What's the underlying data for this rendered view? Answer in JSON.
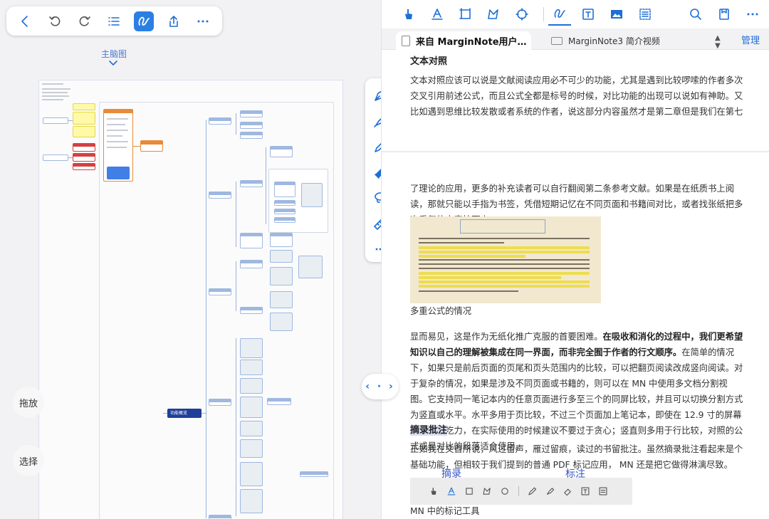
{
  "left": {
    "toolbar": {
      "icons": [
        "back-icon",
        "undo-icon",
        "redo-icon",
        "list-icon",
        "pen-draw-icon",
        "share-icon",
        "more-icon"
      ]
    },
    "mindmap_label": "主脑图",
    "func_node": "功能概览",
    "drag_label": "拖放",
    "select_label": "选择"
  },
  "pen_bar": {
    "tools": [
      "pen-icon",
      "highlighter-icon",
      "pencil-icon",
      "eraser-icon",
      "lasso-icon",
      "ruler-icon",
      "more-icon"
    ],
    "colors": {
      "pen": "#111111",
      "highlighter": "#f2c21b",
      "pencil": "#1e6fd6"
    }
  },
  "right": {
    "toolbar": {
      "icons": [
        "hand-icon",
        "text-underline-icon",
        "rect-select-icon",
        "shape-icon",
        "screenshot-icon",
        "pen-draw-icon",
        "text-box-icon",
        "image-icon",
        "outline-icon",
        "search-icon",
        "bookmark-icon",
        "more-icon"
      ],
      "accent": "#1e6fd6"
    },
    "tabs": {
      "tab1": "来自 MarginNote用户…",
      "tab2": "MarginNote3 简介视频"
    },
    "manage": "管理",
    "doc": {
      "h1": "文本对照",
      "p1": "文本对照应该可以说是文献阅读应用必不可少的功能，尤其是遇到比较啰嗦的作者多次交叉引用前述公式，而且公式全都是标号的时候，对比功能的出现可以说如有神助。又比如遇到思维比较发散或者系统的作者，说这部分内容虽然才是第二章但是我们在第七章中进行了更加深入的讨论，并且在第九章中还引入",
      "p2": "了理论的应用，更多的补充读者可以自行翻阅第二条参考文献。如果是在纸质书上阅读，那就只能以手指为书签，凭借短期记忆在不同页面和书籍间对比，或者找张纸把多次重复的内容抄下来。",
      "caption1": "多重公式的情况",
      "p3_a": "显而易见，这是作为无纸化推广克服的首要困难。",
      "p3_b": "在吸收和消化的过程中，我们更希望知识以自己的理解被集成在同一界面，而非完全囿于作者的行文顺序。",
      "p3_c": "在简单的情况下，如果只是前后页面的页尾和页头范围内的比较，可以把翻页阅读改成竖向阅读。对于复杂的情况，如果是涉及不同页面或书籍的，则可以在 MN 中使用多文档分割视图。它支持同一笔记本内的任意页面进行多至三个的同屏比较，并且可以切换分割方式为竖直或水平。水平多用于页比较，不过三个页面加上笔记本，即使在 12.9 寸的屏幕上也显得吃力，在实际使用的时候建议不要过于贪心；竖直则多用于行比较，对照的公式或是对比的段落适合使用。",
      "h2": "摘录批注",
      "p4": "正如我在文首所说，风过留声，雁过留痕，读过的书留批注。虽然摘录批注看起来是个基础功能，但相较于我们提到的普通 PDF 标记应用， MN 还是把它做得淋漓尽致。",
      "anno_excerpt": "摘录",
      "anno_mark": "标注",
      "caption2": "MN 中的标记工具"
    }
  },
  "split_handle": "‹ · ›"
}
